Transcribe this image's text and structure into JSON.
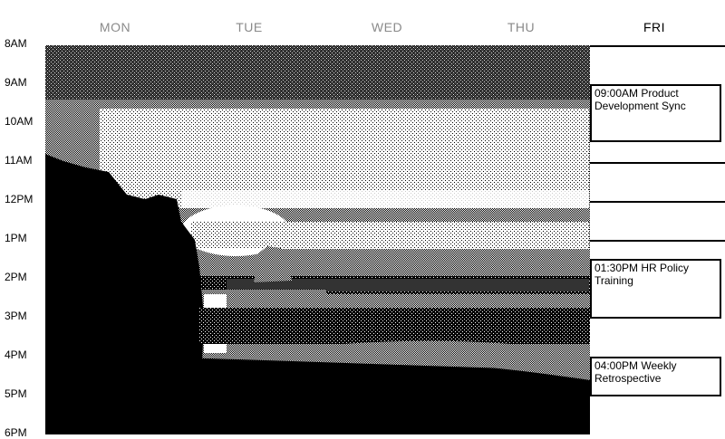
{
  "week": {
    "days": [
      {
        "label": "MON",
        "active": false
      },
      {
        "label": "TUE",
        "active": false
      },
      {
        "label": "WED",
        "active": false
      },
      {
        "label": "THU",
        "active": false
      },
      {
        "label": "FRI",
        "active": true
      }
    ]
  },
  "time_labels": [
    "8AM",
    "9AM",
    "10AM",
    "11AM",
    "12PM",
    "1PM",
    "2PM",
    "3PM",
    "4PM",
    "5PM",
    "6PM"
  ],
  "events": [
    {
      "text": "09:00AM Product Development Sync",
      "day": "FRI"
    },
    {
      "text": "01:30PM HR Policy Training",
      "day": "FRI"
    },
    {
      "text": "04:00PM Weekly Retrospective",
      "day": "FRI"
    }
  ],
  "image": {
    "subject": "dithered-coastal-sunset-photo"
  },
  "colors": {
    "inactive_day": "#8a8a8a",
    "active_day": "#000000",
    "border": "#000000"
  }
}
